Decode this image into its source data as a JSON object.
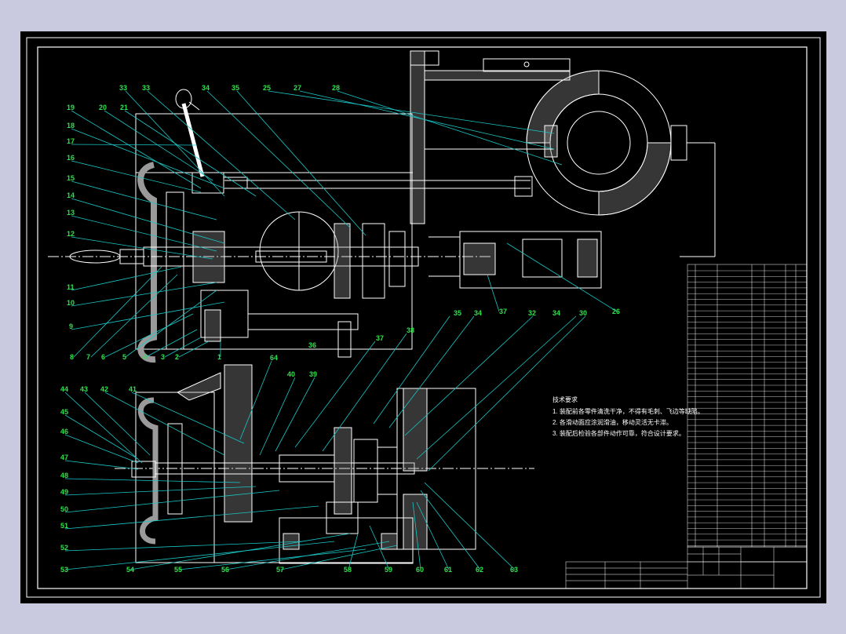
{
  "colors": {
    "background": "#c9cadf",
    "sheet": "#000000",
    "linework": "#ffffff",
    "leaders": "#19c7c7",
    "labels": "#2fe14a"
  },
  "upper_view_labels": [
    {
      "id": "u-33",
      "text": "33"
    },
    {
      "id": "u-33b",
      "text": "33"
    },
    {
      "id": "u-34",
      "text": "34"
    },
    {
      "id": "u-35",
      "text": "35"
    },
    {
      "id": "u-25",
      "text": "25"
    },
    {
      "id": "u-27",
      "text": "27"
    },
    {
      "id": "u-28",
      "text": "28"
    },
    {
      "id": "u-19",
      "text": "19"
    },
    {
      "id": "u-20",
      "text": "20"
    },
    {
      "id": "u-21",
      "text": "21"
    },
    {
      "id": "u-18",
      "text": "18"
    },
    {
      "id": "u-17",
      "text": "17"
    },
    {
      "id": "u-16",
      "text": "16"
    },
    {
      "id": "u-15",
      "text": "15"
    },
    {
      "id": "u-14",
      "text": "14"
    },
    {
      "id": "u-13",
      "text": "13"
    },
    {
      "id": "u-12",
      "text": "12"
    },
    {
      "id": "u-11",
      "text": "11"
    },
    {
      "id": "u-10",
      "text": "10"
    },
    {
      "id": "u-9",
      "text": "9"
    },
    {
      "id": "u-8",
      "text": "8"
    },
    {
      "id": "u-7",
      "text": "7"
    },
    {
      "id": "u-6",
      "text": "6"
    },
    {
      "id": "u-5",
      "text": "5"
    },
    {
      "id": "u-4",
      "text": "4"
    },
    {
      "id": "u-3",
      "text": "3"
    },
    {
      "id": "u-2",
      "text": "2"
    },
    {
      "id": "u-1",
      "text": "1"
    },
    {
      "id": "u-36",
      "text": "36"
    },
    {
      "id": "u-37",
      "text": "37"
    },
    {
      "id": "u-26",
      "text": "26"
    }
  ],
  "lower_view_labels": [
    {
      "id": "l-35",
      "text": "35"
    },
    {
      "id": "l-34",
      "text": "34"
    },
    {
      "id": "l-32",
      "text": "32"
    },
    {
      "id": "l-34b",
      "text": "34"
    },
    {
      "id": "l-30",
      "text": "30"
    },
    {
      "id": "l-37",
      "text": "37"
    },
    {
      "id": "l-38",
      "text": "38"
    },
    {
      "id": "l-39",
      "text": "39"
    },
    {
      "id": "l-40",
      "text": "40"
    },
    {
      "id": "l-64",
      "text": "64"
    },
    {
      "id": "l-44",
      "text": "44"
    },
    {
      "id": "l-43",
      "text": "43"
    },
    {
      "id": "l-42",
      "text": "42"
    },
    {
      "id": "l-41",
      "text": "41"
    },
    {
      "id": "l-45",
      "text": "45"
    },
    {
      "id": "l-46",
      "text": "46"
    },
    {
      "id": "l-47",
      "text": "47"
    },
    {
      "id": "l-48",
      "text": "48"
    },
    {
      "id": "l-49",
      "text": "49"
    },
    {
      "id": "l-50",
      "text": "50"
    },
    {
      "id": "l-51",
      "text": "51"
    },
    {
      "id": "l-52",
      "text": "52"
    },
    {
      "id": "l-53",
      "text": "53"
    },
    {
      "id": "l-54",
      "text": "54"
    },
    {
      "id": "l-55",
      "text": "55"
    },
    {
      "id": "l-56",
      "text": "56"
    },
    {
      "id": "l-57",
      "text": "57"
    },
    {
      "id": "l-58",
      "text": "58"
    },
    {
      "id": "l-59",
      "text": "59"
    },
    {
      "id": "l-60",
      "text": "60"
    },
    {
      "id": "l-61",
      "text": "61"
    },
    {
      "id": "l-62",
      "text": "62"
    },
    {
      "id": "l-63",
      "text": "63"
    }
  ],
  "notes": {
    "heading": "技术要求",
    "items": [
      "1. 装配前各零件清洗干净，不得有毛刺、飞边等缺陷。",
      "2. 各滑动面应涂润滑油，移动灵活无卡滞。",
      "3. 装配后检验各部件动作可靠，符合设计要求。"
    ]
  }
}
